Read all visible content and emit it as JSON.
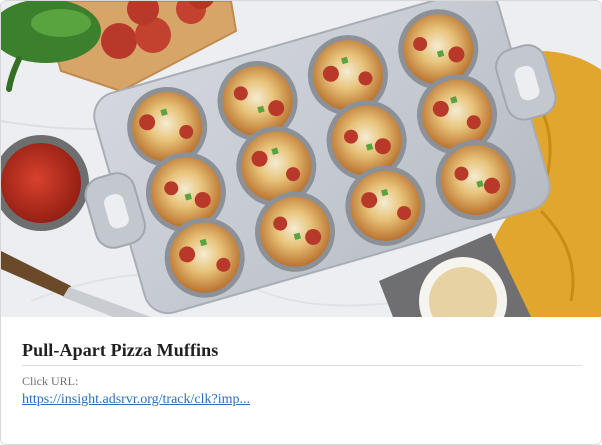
{
  "ad": {
    "title": "Pull-Apart Pizza Muffins",
    "click_url_label": "Click URL:",
    "click_url": "https://insight.adsrvr.org/track/clk?imp..."
  },
  "image": {
    "subject": "muffin-tin-with-pizza-muffins",
    "colors": {
      "background": "#e9ebee",
      "tray": "#c7ccd3",
      "muffin": "#e3b45d",
      "cheese": "#f3ead0",
      "pepperoni": "#b8392a",
      "pepper": "#4f9a3b",
      "towel": "#e1a62d",
      "board": "#d8a569",
      "sauce": "#b52a1c"
    }
  },
  "link_color": "#2a6ebb"
}
